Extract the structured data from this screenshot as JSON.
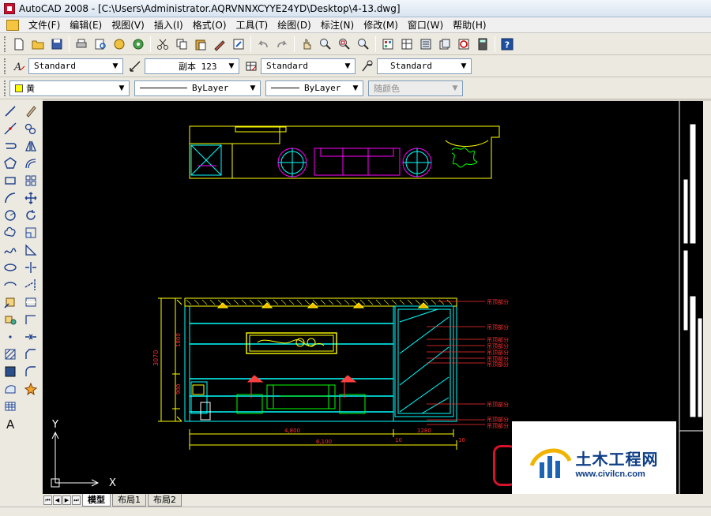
{
  "window": {
    "title": "AutoCAD 2008 - [C:\\Users\\Administrator.AQRVNNXCYYE24YD\\Desktop\\4-13.dwg]"
  },
  "menu": {
    "items": [
      "文件(F)",
      "编辑(E)",
      "视图(V)",
      "插入(I)",
      "格式(O)",
      "工具(T)",
      "绘图(D)",
      "标注(N)",
      "修改(M)",
      "窗口(W)",
      "帮助(H)"
    ]
  },
  "styles": {
    "text_style": "Standard",
    "dim_style": "副本 123",
    "table_style": "Standard",
    "multileader_style": "Standard"
  },
  "properties": {
    "layer": "黄",
    "layer_color": "#ffff00",
    "linetype": "ByLayer",
    "lineweight": "ByLayer",
    "plot_style": "随颜色"
  },
  "drawing": {
    "ucs_x": "X",
    "ucs_y": "Y",
    "dim_left_total": "3070",
    "dim_left_upper": "1800",
    "dim_left_lower": "900",
    "dim_bottom_1": "4,800",
    "dim_bottom_2": "1280",
    "dim_bottom_3": "10",
    "dim_bottom_total": "6,100",
    "dim_bottom_end": "10",
    "callouts": [
      "吊顶部分",
      "吊顶部分",
      "吊顶部分",
      "吊顶部分",
      "吊顶部分",
      "吊顶部分",
      "吊顶部分",
      "吊顶部分",
      "吊顶部分",
      "吊顶部分"
    ]
  },
  "tabs": {
    "items": [
      "模型",
      "布局1",
      "布局2"
    ],
    "active": 0
  },
  "watermark": {
    "name": "土木工程网",
    "url": "www.civilcn.com"
  },
  "colors": {
    "canvas": "#000000",
    "cad_yellow": "#ffff00",
    "cad_cyan": "#00ffff",
    "cad_magenta": "#ff00ff",
    "cad_red": "#ff0000",
    "cad_green": "#00ff00"
  }
}
